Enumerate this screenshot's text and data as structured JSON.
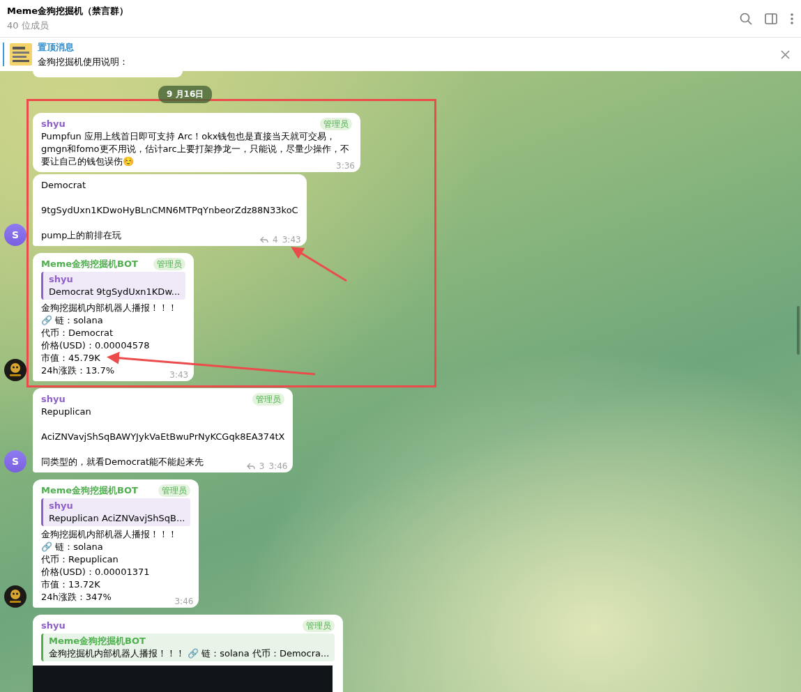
{
  "header": {
    "title": "Meme金狗挖掘机（禁言群）",
    "subtitle": "40 位成员"
  },
  "pinned": {
    "title": "置顶消息",
    "text": "金狗挖掘机使用说明："
  },
  "date_separator": "9 月16日",
  "messages": [
    {
      "kind": "text",
      "sender": "shyu",
      "color": "#8e5fc9",
      "admin_badge": "管理员",
      "paragraphs": [
        "Pumpfun 应用上线首日即可支持 Arc！okx钱包也是直接当天就可交易，gmgn和fomo更不用说，估计arc上要打架挣龙一，只能说，尽量少操作，不要让自己的钱包误伤☺️"
      ],
      "time": "3:36"
    },
    {
      "kind": "text",
      "paragraphs": [
        "Democrat",
        "9tgSydUxn1KDwoHyBLnCMN6MTPqYnbeorZdz88N33koC",
        "pump上的前排在玩"
      ],
      "replies": "4",
      "time": "3:43",
      "avatar": {
        "kind": "letter",
        "letter": "S"
      }
    },
    {
      "kind": "lines",
      "sender": "Meme金狗挖掘机BOT",
      "color": "#4fae4e",
      "admin_badge": "管理员",
      "reply": {
        "name": "shyu",
        "color": "#8e5fc9",
        "text": "Democrat  9tgSydUxn1KDw..."
      },
      "lines": [
        "金狗挖掘机内部机器人播报！！！",
        "🔗 链：solana",
        "代币：Democrat",
        "价格(USD)：0.00004578",
        "市值：45.79K",
        "24h涨跌：13.7%"
      ],
      "time": "3:43",
      "avatar": {
        "kind": "logo"
      }
    },
    {
      "kind": "text",
      "sender": "shyu",
      "color": "#8e5fc9",
      "admin_badge": "管理员",
      "paragraphs": [
        "Repuplican",
        "AciZNVavjShSqBAWYJykVaEtBwuPrNyKCGqk8EA374tX",
        "同类型的，就看Democrat能不能起来先"
      ],
      "replies": "3",
      "time": "3:46",
      "avatar": {
        "kind": "letter",
        "letter": "S"
      }
    },
    {
      "kind": "lines",
      "sender": "Meme金狗挖掘机BOT",
      "color": "#4fae4e",
      "admin_badge": "管理员",
      "reply": {
        "name": "shyu",
        "color": "#8e5fc9",
        "text": "Repuplican  AciZNVavjShSqB..."
      },
      "lines": [
        "金狗挖掘机内部机器人播报！！！",
        "🔗 链：solana",
        "代币：Repuplican",
        "价格(USD)：0.00001371",
        "市值：13.72K",
        "24h涨跌：347%"
      ],
      "time": "3:46",
      "avatar": {
        "kind": "logo"
      }
    },
    {
      "kind": "screenshot",
      "sender": "shyu",
      "color": "#8e5fc9",
      "admin_badge": "管理员",
      "reply": {
        "name": "Meme金狗挖掘机BOT",
        "color": "#4fae4e",
        "text": "金狗挖掘机内部机器人播报！！！ 🔗 链：solana 代币：Democra..."
      }
    }
  ]
}
